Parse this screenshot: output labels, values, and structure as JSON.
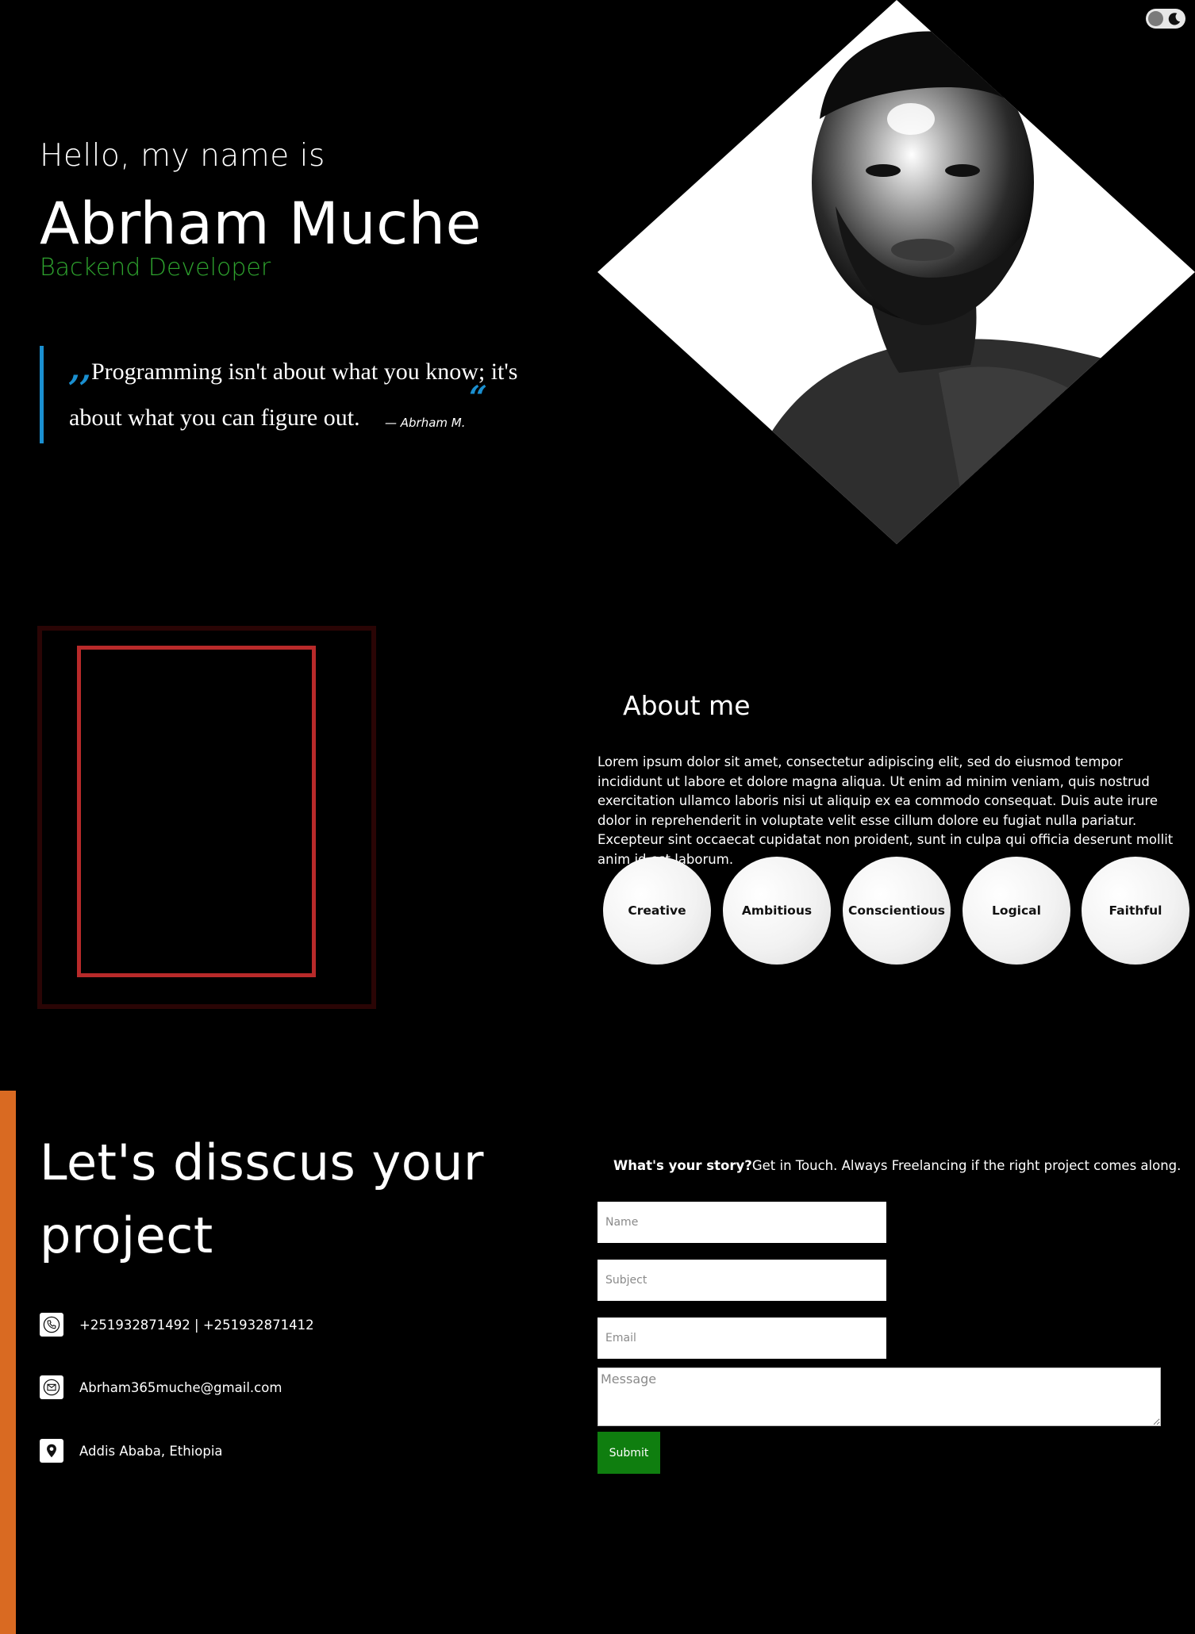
{
  "theme_toggle": {
    "icon": "moon-icon"
  },
  "hero": {
    "greeting": "Hello, my name is",
    "name": "Abrham Muche",
    "role": "Backend Developer",
    "role_color": "#2ea32e",
    "quote_line1": "Programming isn't about what you know; it's",
    "quote_line2": "about what you can figure out.",
    "quote_author": "— Abrham M.",
    "quote_accent_color": "#1a8fd0"
  },
  "about": {
    "title": "About me",
    "text": "Lorem ipsum dolor sit amet, consectetur adipiscing elit, sed do eiusmod tempor incididunt ut labore et dolore magna aliqua. Ut enim ad minim veniam, quis nostrud exercitation ullamco laboris nisi ut aliquip ex ea commodo consequat. Duis aute irure dolor in reprehenderit in voluptate velit esse cillum dolore eu fugiat nulla pariatur. Excepteur sint occaecat cupidatat non proident, sunt in culpa qui officia deserunt mollit anim id est laborum.",
    "traits": [
      "Creative",
      "Ambitious",
      "Conscientious",
      "Logical",
      "Faithful"
    ],
    "frame_colors": {
      "outer": "#2a0505",
      "inner": "#b82a2a"
    }
  },
  "contact": {
    "title": "Let's disscus your project",
    "accent_color": "#d96a22",
    "items": [
      {
        "icon": "phone-icon",
        "text": "+251932871492 | +251932871412"
      },
      {
        "icon": "envelope-icon",
        "text": "Abrham365muche@gmail.com"
      },
      {
        "icon": "location-pin-icon",
        "text": "Addis Ababa, Ethiopia"
      }
    ],
    "intro_bold": "What's your story?",
    "intro_rest": "Get in Touch. Always Freelancing if the right project comes along.",
    "form": {
      "name_placeholder": "Name",
      "subject_placeholder": "Subject",
      "email_placeholder": "Email",
      "message_placeholder": "Message",
      "submit_label": "Submit",
      "submit_color": "#0f7e0f"
    }
  }
}
